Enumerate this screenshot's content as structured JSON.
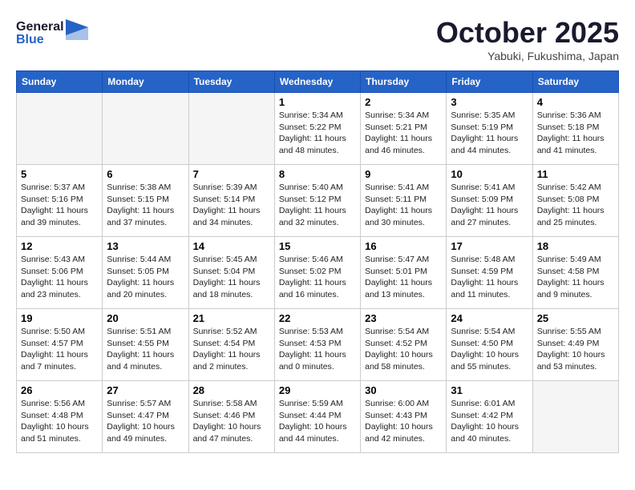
{
  "header": {
    "logo_general": "General",
    "logo_blue": "Blue",
    "month_title": "October 2025",
    "location": "Yabuki, Fukushima, Japan"
  },
  "weekdays": [
    "Sunday",
    "Monday",
    "Tuesday",
    "Wednesday",
    "Thursday",
    "Friday",
    "Saturday"
  ],
  "weeks": [
    [
      {
        "day": "",
        "info": ""
      },
      {
        "day": "",
        "info": ""
      },
      {
        "day": "",
        "info": ""
      },
      {
        "day": "1",
        "info": "Sunrise: 5:34 AM\nSunset: 5:22 PM\nDaylight: 11 hours\nand 48 minutes."
      },
      {
        "day": "2",
        "info": "Sunrise: 5:34 AM\nSunset: 5:21 PM\nDaylight: 11 hours\nand 46 minutes."
      },
      {
        "day": "3",
        "info": "Sunrise: 5:35 AM\nSunset: 5:19 PM\nDaylight: 11 hours\nand 44 minutes."
      },
      {
        "day": "4",
        "info": "Sunrise: 5:36 AM\nSunset: 5:18 PM\nDaylight: 11 hours\nand 41 minutes."
      }
    ],
    [
      {
        "day": "5",
        "info": "Sunrise: 5:37 AM\nSunset: 5:16 PM\nDaylight: 11 hours\nand 39 minutes."
      },
      {
        "day": "6",
        "info": "Sunrise: 5:38 AM\nSunset: 5:15 PM\nDaylight: 11 hours\nand 37 minutes."
      },
      {
        "day": "7",
        "info": "Sunrise: 5:39 AM\nSunset: 5:14 PM\nDaylight: 11 hours\nand 34 minutes."
      },
      {
        "day": "8",
        "info": "Sunrise: 5:40 AM\nSunset: 5:12 PM\nDaylight: 11 hours\nand 32 minutes."
      },
      {
        "day": "9",
        "info": "Sunrise: 5:41 AM\nSunset: 5:11 PM\nDaylight: 11 hours\nand 30 minutes."
      },
      {
        "day": "10",
        "info": "Sunrise: 5:41 AM\nSunset: 5:09 PM\nDaylight: 11 hours\nand 27 minutes."
      },
      {
        "day": "11",
        "info": "Sunrise: 5:42 AM\nSunset: 5:08 PM\nDaylight: 11 hours\nand 25 minutes."
      }
    ],
    [
      {
        "day": "12",
        "info": "Sunrise: 5:43 AM\nSunset: 5:06 PM\nDaylight: 11 hours\nand 23 minutes."
      },
      {
        "day": "13",
        "info": "Sunrise: 5:44 AM\nSunset: 5:05 PM\nDaylight: 11 hours\nand 20 minutes."
      },
      {
        "day": "14",
        "info": "Sunrise: 5:45 AM\nSunset: 5:04 PM\nDaylight: 11 hours\nand 18 minutes."
      },
      {
        "day": "15",
        "info": "Sunrise: 5:46 AM\nSunset: 5:02 PM\nDaylight: 11 hours\nand 16 minutes."
      },
      {
        "day": "16",
        "info": "Sunrise: 5:47 AM\nSunset: 5:01 PM\nDaylight: 11 hours\nand 13 minutes."
      },
      {
        "day": "17",
        "info": "Sunrise: 5:48 AM\nSunset: 4:59 PM\nDaylight: 11 hours\nand 11 minutes."
      },
      {
        "day": "18",
        "info": "Sunrise: 5:49 AM\nSunset: 4:58 PM\nDaylight: 11 hours\nand 9 minutes."
      }
    ],
    [
      {
        "day": "19",
        "info": "Sunrise: 5:50 AM\nSunset: 4:57 PM\nDaylight: 11 hours\nand 7 minutes."
      },
      {
        "day": "20",
        "info": "Sunrise: 5:51 AM\nSunset: 4:55 PM\nDaylight: 11 hours\nand 4 minutes."
      },
      {
        "day": "21",
        "info": "Sunrise: 5:52 AM\nSunset: 4:54 PM\nDaylight: 11 hours\nand 2 minutes."
      },
      {
        "day": "22",
        "info": "Sunrise: 5:53 AM\nSunset: 4:53 PM\nDaylight: 11 hours\nand 0 minutes."
      },
      {
        "day": "23",
        "info": "Sunrise: 5:54 AM\nSunset: 4:52 PM\nDaylight: 10 hours\nand 58 minutes."
      },
      {
        "day": "24",
        "info": "Sunrise: 5:54 AM\nSunset: 4:50 PM\nDaylight: 10 hours\nand 55 minutes."
      },
      {
        "day": "25",
        "info": "Sunrise: 5:55 AM\nSunset: 4:49 PM\nDaylight: 10 hours\nand 53 minutes."
      }
    ],
    [
      {
        "day": "26",
        "info": "Sunrise: 5:56 AM\nSunset: 4:48 PM\nDaylight: 10 hours\nand 51 minutes."
      },
      {
        "day": "27",
        "info": "Sunrise: 5:57 AM\nSunset: 4:47 PM\nDaylight: 10 hours\nand 49 minutes."
      },
      {
        "day": "28",
        "info": "Sunrise: 5:58 AM\nSunset: 4:46 PM\nDaylight: 10 hours\nand 47 minutes."
      },
      {
        "day": "29",
        "info": "Sunrise: 5:59 AM\nSunset: 4:44 PM\nDaylight: 10 hours\nand 44 minutes."
      },
      {
        "day": "30",
        "info": "Sunrise: 6:00 AM\nSunset: 4:43 PM\nDaylight: 10 hours\nand 42 minutes."
      },
      {
        "day": "31",
        "info": "Sunrise: 6:01 AM\nSunset: 4:42 PM\nDaylight: 10 hours\nand 40 minutes."
      },
      {
        "day": "",
        "info": ""
      }
    ]
  ]
}
